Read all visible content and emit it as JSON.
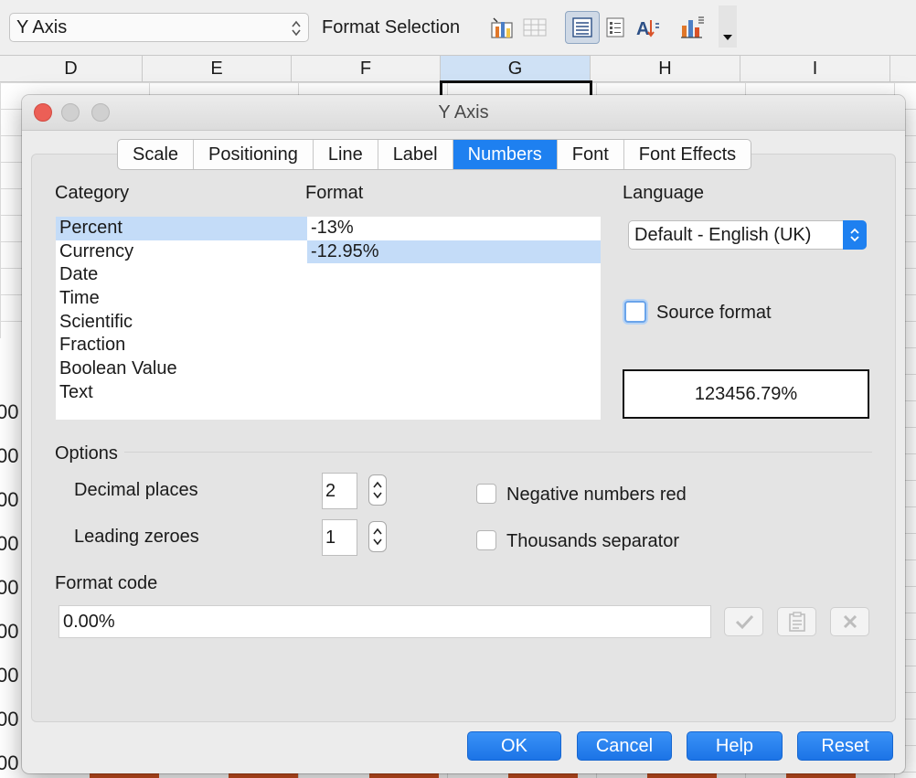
{
  "toolbar": {
    "element_select": "Y Axis",
    "format_selection_label": "Format Selection",
    "icons": [
      "insert-chart-elements-icon",
      "data-table-icon",
      "legend-on-off-icon",
      "horizontal-grids-icon",
      "format-title-icon",
      "chart-type-icon"
    ]
  },
  "sheet": {
    "columns": [
      "D",
      "E",
      "F",
      "G",
      "H",
      "I"
    ],
    "selected_column": "G",
    "axis_labels": [
      "00",
      "00",
      "00",
      "00",
      "00",
      "00",
      "00",
      "00",
      "00"
    ]
  },
  "dialog": {
    "title": "Y Axis",
    "tabs": [
      "Scale",
      "Positioning",
      "Line",
      "Label",
      "Numbers",
      "Font",
      "Font Effects"
    ],
    "active_tab": "Numbers",
    "category_label": "Category",
    "categories": [
      "Percent",
      "Currency",
      "Date",
      "Time",
      "Scientific",
      "Fraction",
      "Boolean Value",
      "Text"
    ],
    "selected_category": "Percent",
    "format_label": "Format",
    "formats": [
      "-13%",
      "-12.95%"
    ],
    "selected_format": "-12.95%",
    "language_label": "Language",
    "language_value": "Default - English (UK)",
    "source_format_label": "Source format",
    "source_format_checked": false,
    "preview_value": "123456.79%",
    "options_label": "Options",
    "decimal_places_label": "Decimal places",
    "decimal_places_value": "2",
    "leading_zeroes_label": "Leading zeroes",
    "leading_zeroes_value": "1",
    "negative_red_label": "Negative numbers red",
    "negative_red_checked": false,
    "thousands_sep_label": "Thousands separator",
    "thousands_sep_checked": false,
    "format_code_label": "Format code",
    "format_code_value": "0.00%",
    "buttons": {
      "ok": "OK",
      "cancel": "Cancel",
      "help": "Help",
      "reset": "Reset"
    }
  },
  "colors": {
    "accent": "#1e80f0",
    "selection": "#c4dcf8",
    "chart_bar": "#c9501f",
    "close_button": "#ec5f56"
  }
}
